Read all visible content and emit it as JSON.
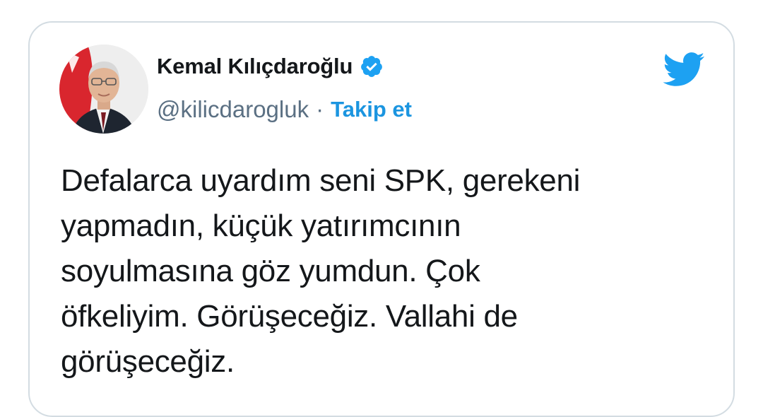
{
  "tweet": {
    "display_name": "Kemal Kılıçdaroğlu",
    "handle": "@kilicdarogluk",
    "separator": "·",
    "follow_label": "Takip et",
    "text": "Defalarca uyardım seni SPK, gerekeni\nyapmadın, küçük yatırımcının\nsoyulmasına göz yumdun. Çok\nöfkeliyim. Görüşeceğiz. Vallahi de\ngörüşeceğiz."
  },
  "icons": {
    "verified": "verified-badge-icon",
    "brand": "twitter-bird-icon",
    "avatar": "profile-photo"
  },
  "colors": {
    "accent": "#1b95e0",
    "text": "#14171a",
    "secondary_text": "#5b7083",
    "border": "#d3dce2",
    "twitter_blue": "#1da1f2"
  }
}
